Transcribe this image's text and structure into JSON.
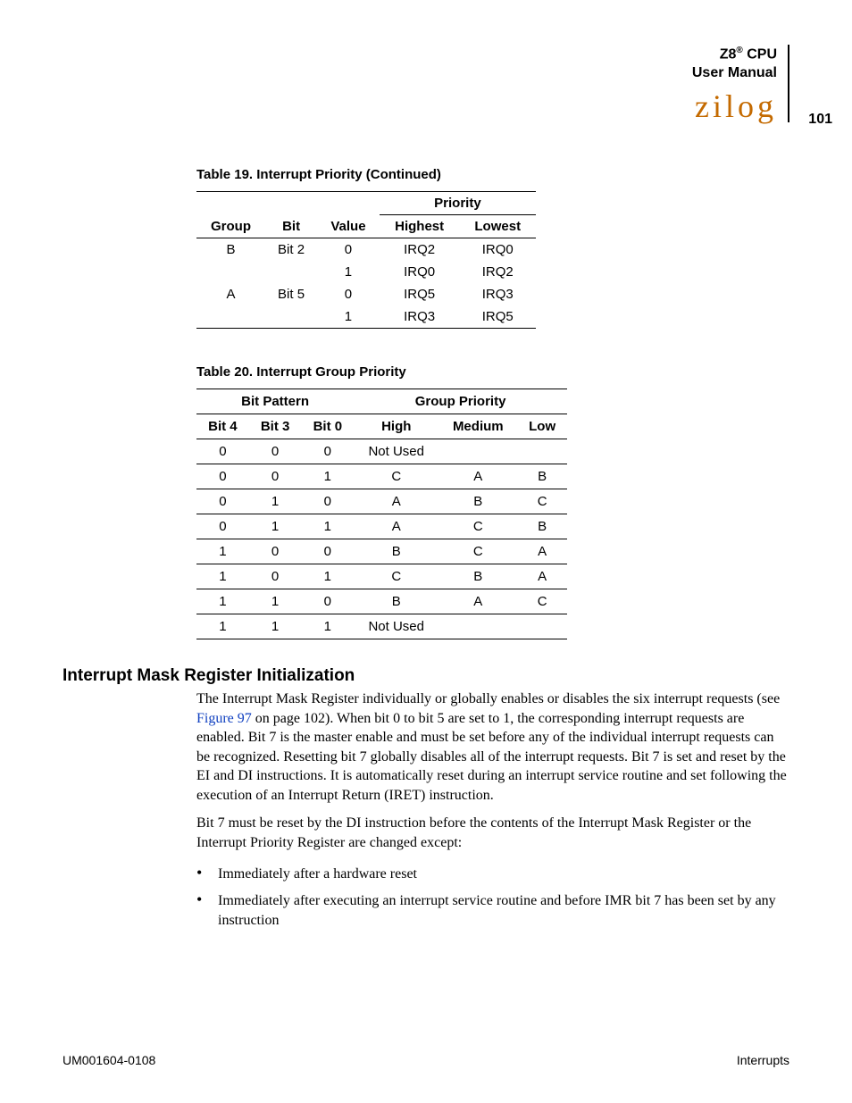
{
  "header": {
    "product": "Z8",
    "sup": "®",
    "suffix": " CPU",
    "subtitle": "User Manual",
    "logo": "zilog",
    "page_number": "101"
  },
  "table19": {
    "caption": "Table 19. Interrupt Priority (Continued)",
    "group_head": "Priority",
    "cols": [
      "Group",
      "Bit",
      "Value",
      "Highest",
      "Lowest"
    ],
    "rows": [
      {
        "group": "B",
        "bit": "Bit 2",
        "value": "0",
        "high": "IRQ2",
        "low": "IRQ0"
      },
      {
        "group": "",
        "bit": "",
        "value": "1",
        "high": "IRQ0",
        "low": "IRQ2"
      },
      {
        "group": "A",
        "bit": "Bit 5",
        "value": "0",
        "high": "IRQ5",
        "low": "IRQ3"
      },
      {
        "group": "",
        "bit": "",
        "value": "1",
        "high": "IRQ3",
        "low": "IRQ5"
      }
    ]
  },
  "table20": {
    "caption": "Table 20. Interrupt Group Priority",
    "group_heads": [
      "Bit Pattern",
      "Group Priority"
    ],
    "cols": [
      "Bit 4",
      "Bit 3",
      "Bit 0",
      "High",
      "Medium",
      "Low"
    ],
    "rows": [
      {
        "b4": "0",
        "b3": "0",
        "b0": "0",
        "hi": "Not Used",
        "md": "",
        "lo": ""
      },
      {
        "b4": "0",
        "b3": "0",
        "b0": "1",
        "hi": "C",
        "md": "A",
        "lo": "B"
      },
      {
        "b4": "0",
        "b3": "1",
        "b0": "0",
        "hi": "A",
        "md": "B",
        "lo": "C"
      },
      {
        "b4": "0",
        "b3": "1",
        "b0": "1",
        "hi": "A",
        "md": "C",
        "lo": "B"
      },
      {
        "b4": "1",
        "b3": "0",
        "b0": "0",
        "hi": "B",
        "md": "C",
        "lo": "A"
      },
      {
        "b4": "1",
        "b3": "0",
        "b0": "1",
        "hi": "C",
        "md": "B",
        "lo": "A"
      },
      {
        "b4": "1",
        "b3": "1",
        "b0": "0",
        "hi": "B",
        "md": "A",
        "lo": "C"
      },
      {
        "b4": "1",
        "b3": "1",
        "b0": "1",
        "hi": "Not Used",
        "md": "",
        "lo": ""
      }
    ]
  },
  "section": {
    "heading": "Interrupt Mask Register Initialization",
    "p1a": "The Interrupt Mask Register individually or globally enables or disables the six interrupt requests (see ",
    "p1link": "Figure 97",
    "p1b": " on page 102). When bit 0 to bit 5 are set to 1, the corresponding interrupt requests are enabled. Bit 7 is the master enable and must be set before any of the individual interrupt requests can be recognized. Resetting bit 7 globally disables all of the interrupt requests. Bit 7 is set and reset by the EI and DI instructions. It is automatically reset during an interrupt service routine and set following the execution of an Interrupt Return (IRET) instruction.",
    "p2": "Bit 7 must be reset by the DI instruction before the contents of the Interrupt Mask Register or the Interrupt Priority Register are changed except:",
    "bullets": [
      "Immediately after a hardware reset",
      "Immediately after executing an interrupt service routine and before IMR bit 7 has been set by any instruction"
    ]
  },
  "footer": {
    "left": "UM001604-0108",
    "right": "Interrupts"
  }
}
